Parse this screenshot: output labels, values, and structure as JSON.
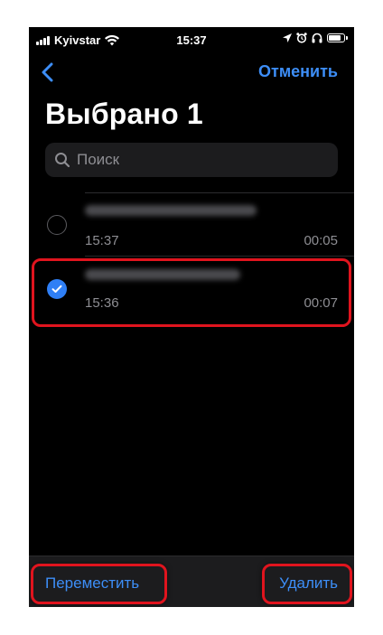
{
  "status_bar": {
    "carrier": "Kyivstar",
    "time": "15:37"
  },
  "nav": {
    "back_icon": "chevron-left-icon",
    "cancel_label": "Отменить"
  },
  "title": "Выбрано 1",
  "search": {
    "placeholder": "Поиск"
  },
  "recordings": [
    {
      "time": "15:37",
      "duration": "00:05",
      "selected": false
    },
    {
      "time": "15:36",
      "duration": "00:07",
      "selected": true
    }
  ],
  "toolbar": {
    "move_label": "Переместить",
    "delete_label": "Удалить"
  },
  "colors": {
    "accent": "#3d8ef7",
    "highlight": "#e0141e",
    "background": "#000000"
  }
}
